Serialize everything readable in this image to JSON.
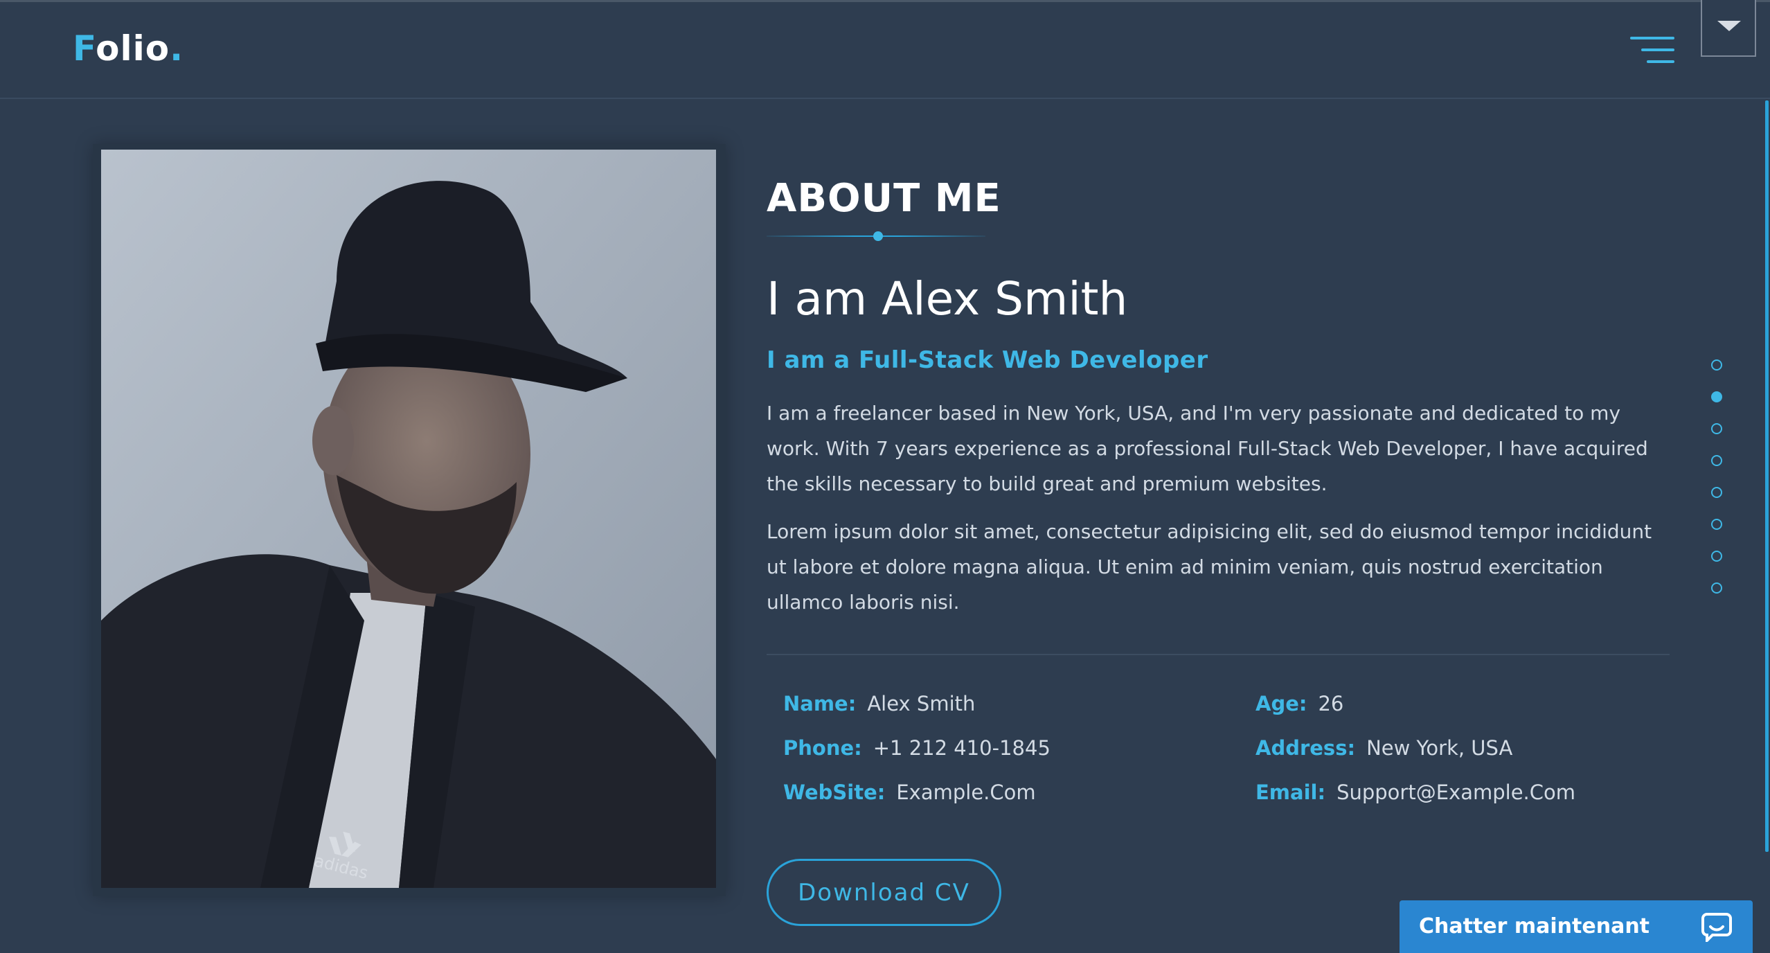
{
  "brand": {
    "logo_first": "F",
    "logo_rest": "olio",
    "logo_dot": "."
  },
  "about": {
    "section_title": "ABOUT ME",
    "greeting": "I am Alex Smith",
    "role": "I am a Full-Stack Web Developer",
    "paragraph_1": "I am a freelancer based in New York, USA, and I'm very passionate and dedicated to my work. With 7 years experience as a professional Full-Stack Web Developer, I have acquired the skills necessary to build great and premium websites.",
    "paragraph_2": "Lorem ipsum dolor sit amet, consectetur adipisicing elit, sed do eiusmod tempor incididunt ut labore et dolore magna aliqua. Ut enim ad minim veniam, quis nostrud exercitation ullamco laboris nisi."
  },
  "info": {
    "name_label": "Name:",
    "name_value": "Alex Smith",
    "phone_label": "Phone:",
    "phone_value": "+1 212 410-1845",
    "website_label": "WebSite:",
    "website_value": "Example.Com",
    "age_label": "Age:",
    "age_value": "26",
    "address_label": "Address:",
    "address_value": "New York, USA",
    "email_label": "Email:",
    "email_value": "Support@Example.Com"
  },
  "download_button": "Download CV",
  "photo_logo_text": "adidas",
  "section_dots": {
    "count": 8,
    "active_index": 1
  },
  "chat": {
    "label": "Chatter maintenant"
  },
  "colors": {
    "background": "#2e3d50",
    "accent": "#3fb8e6",
    "chat": "#2a86d1"
  },
  "icons": {
    "menu": "hamburger-menu-icon",
    "dropdown": "caret-down-icon",
    "chat": "chat-bubble-icon"
  }
}
